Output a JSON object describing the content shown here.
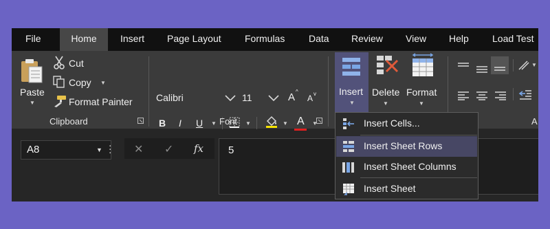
{
  "menubar": {
    "tabs": [
      "File",
      "Home",
      "Insert",
      "Page Layout",
      "Formulas",
      "Data",
      "Review",
      "View",
      "Help",
      "Load Test"
    ],
    "active_tab": "Home"
  },
  "clipboard": {
    "paste_label": "Paste",
    "cut_label": "Cut",
    "copy_label": "Copy",
    "format_painter_label": "Format Painter",
    "group_label": "Clipboard"
  },
  "font": {
    "font_name": "Calibri",
    "font_size": "11",
    "increase_font_label": "A",
    "decrease_font_label": "A",
    "bold_label": "B",
    "italic_label": "I",
    "underline_label": "U",
    "font_color_label": "A",
    "group_label": "Font"
  },
  "cells": {
    "insert_label": "Insert",
    "delete_label": "Delete",
    "format_label": "Format"
  },
  "alignment": {
    "group_label_partial": "A"
  },
  "insert_menu": {
    "items": [
      {
        "label": "Insert Cells...",
        "highlighted": false
      },
      {
        "label": "Insert Sheet Rows",
        "highlighted": true
      },
      {
        "label": "Insert Sheet Columns",
        "highlighted": false
      },
      {
        "label": "Insert Sheet",
        "highlighted": false
      }
    ]
  },
  "formula_bar": {
    "name_box": "A8",
    "value": "5",
    "fx_label": "fx"
  },
  "colors": {
    "backdrop": "#6b63c4",
    "menubar": "#111111",
    "ribbon": "#3b3b3b",
    "active_tab": "#474747",
    "highlight": "#474764",
    "accent_blue": "#7aa6e6",
    "delete_red": "#e05a3a",
    "font_color_red": "#e02020"
  }
}
